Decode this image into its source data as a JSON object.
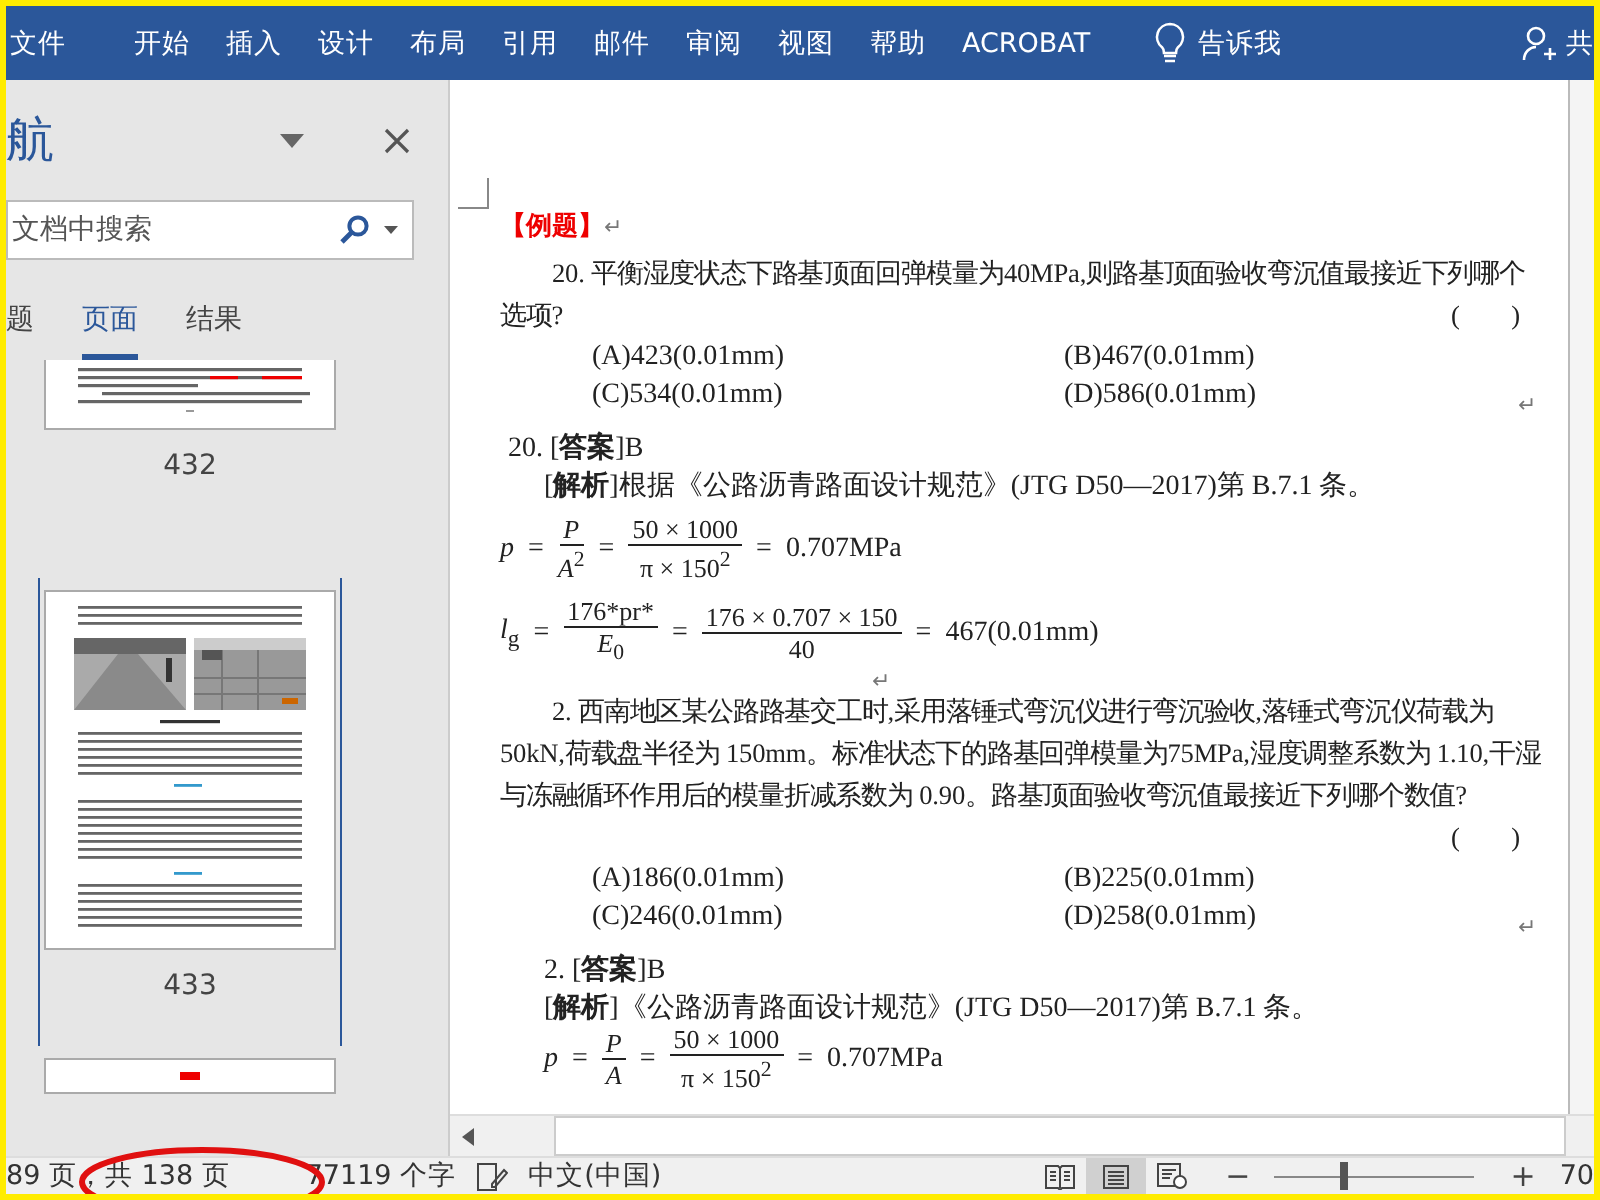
{
  "ribbon": {
    "tabs": [
      {
        "label": "文件"
      },
      {
        "label": "开始"
      },
      {
        "label": "插入"
      },
      {
        "label": "设计"
      },
      {
        "label": "布局"
      },
      {
        "label": "引用"
      },
      {
        "label": "邮件"
      },
      {
        "label": "审阅"
      },
      {
        "label": "视图"
      },
      {
        "label": "帮助"
      },
      {
        "label": "ACROBAT"
      }
    ],
    "tell_me": "告诉我",
    "share": "共"
  },
  "nav": {
    "title": "航",
    "search": {
      "placeholder": "文档中搜索"
    },
    "tabs": [
      {
        "label": "题",
        "selected": false
      },
      {
        "label": "页面",
        "selected": true
      },
      {
        "label": "结果",
        "selected": false
      }
    ],
    "pages": [
      {
        "label": "432",
        "kind": "text",
        "selected": false
      },
      {
        "label": "433",
        "kind": "photos",
        "selected": true
      },
      {
        "kind": "marked",
        "selected": false
      }
    ]
  },
  "document": {
    "blocks": [
      {
        "kind": "heading",
        "text": "【例题】",
        "mark": "↵"
      },
      {
        "kind": "para",
        "text": "20. 平衡湿度状态下路基顶面回弹模量为40MPa,则路基顶面验收弯沉值最接近下列哪个选项?",
        "blank": "(　　)"
      },
      {
        "kind": "options",
        "items": [
          "(A)423(0.01mm)",
          "(B)467(0.01mm)",
          "(C)534(0.01mm)",
          "(D)586(0.01mm)"
        ],
        "mark": "↵"
      },
      {
        "kind": "answer",
        "text": "20. [**答案**]B"
      },
      {
        "kind": "analysis",
        "text": "[**解析**]根据《公路沥青路面设计规范》(JTG D50—2017)第 B.7.1 条。"
      },
      {
        "kind": "formula",
        "lhs": "*p*",
        "terms": [
          {
            "kind": "op",
            "text": "="
          },
          {
            "kind": "frac",
            "num": "*P*",
            "den": "*A*$^{2}$"
          },
          {
            "kind": "op",
            "text": "="
          },
          {
            "kind": "frac",
            "num": "50 × 1000",
            "den": "π × 150$^{2}$"
          },
          {
            "kind": "op",
            "text": "="
          },
          {
            "kind": "text",
            "text": "0.707MPa"
          }
        ]
      },
      {
        "kind": "formula",
        "lhs": "*l*$_{g}$",
        "terms": [
          {
            "kind": "op",
            "text": "="
          },
          {
            "kind": "frac",
            "num": "176*pr*",
            "den": "*E*$_{0}$"
          },
          {
            "kind": "op",
            "text": "="
          },
          {
            "kind": "frac",
            "num": "176 × 0.707 × 150",
            "den": "40"
          },
          {
            "kind": "op",
            "text": "="
          },
          {
            "kind": "text",
            "text": "467(0.01mm)"
          }
        ],
        "mark": "↵"
      },
      {
        "kind": "para",
        "text": "2. 西南地区某公路路基交工时,采用落锤式弯沉仪进行弯沉验收,落锤式弯沉仪荷载为50kN,荷载盘半径为 150mm。标准状态下的路基回弹模量为75MPa,湿度调整系数为 1.10,干湿与冻融循环作用后的模量折减系数为 0.90。路基顶面验收弯沉值最接近下列哪个数值?",
        "blank": "(　　)"
      },
      {
        "kind": "options",
        "items": [
          "(A)186(0.01mm)",
          "(B)225(0.01mm)",
          "(C)246(0.01mm)",
          "(D)258(0.01mm)"
        ],
        "mark": "↵"
      },
      {
        "kind": "answer2",
        "text": "2. [**答案**]B"
      },
      {
        "kind": "analysis",
        "text": "[**解析**]《公路沥青路面设计规范》(JTG D50—2017)第 B.7.1 条。"
      },
      {
        "kind": "formula2",
        "lhs": "*p*",
        "terms": [
          {
            "kind": "op",
            "text": "="
          },
          {
            "kind": "frac",
            "num": "*P*",
            "den": "*A*"
          },
          {
            "kind": "op",
            "text": "="
          },
          {
            "kind": "frac",
            "num": "50 × 1000",
            "den": "π × 150$^{2}$"
          },
          {
            "kind": "op",
            "text": "="
          },
          {
            "kind": "text",
            "text": "0.707MPa"
          }
        ]
      }
    ]
  },
  "status_bar": {
    "page": "89 页，共 138 页",
    "words": "77119 个字",
    "language": "中文(中国)",
    "views": [
      {
        "kind": "read",
        "selected": false
      },
      {
        "kind": "print",
        "selected": true
      },
      {
        "kind": "web",
        "selected": false
      }
    ],
    "zoom_out": "−",
    "zoom_slider": {
      "level": 0.35
    },
    "zoom_in": "+",
    "zoom": "70"
  }
}
